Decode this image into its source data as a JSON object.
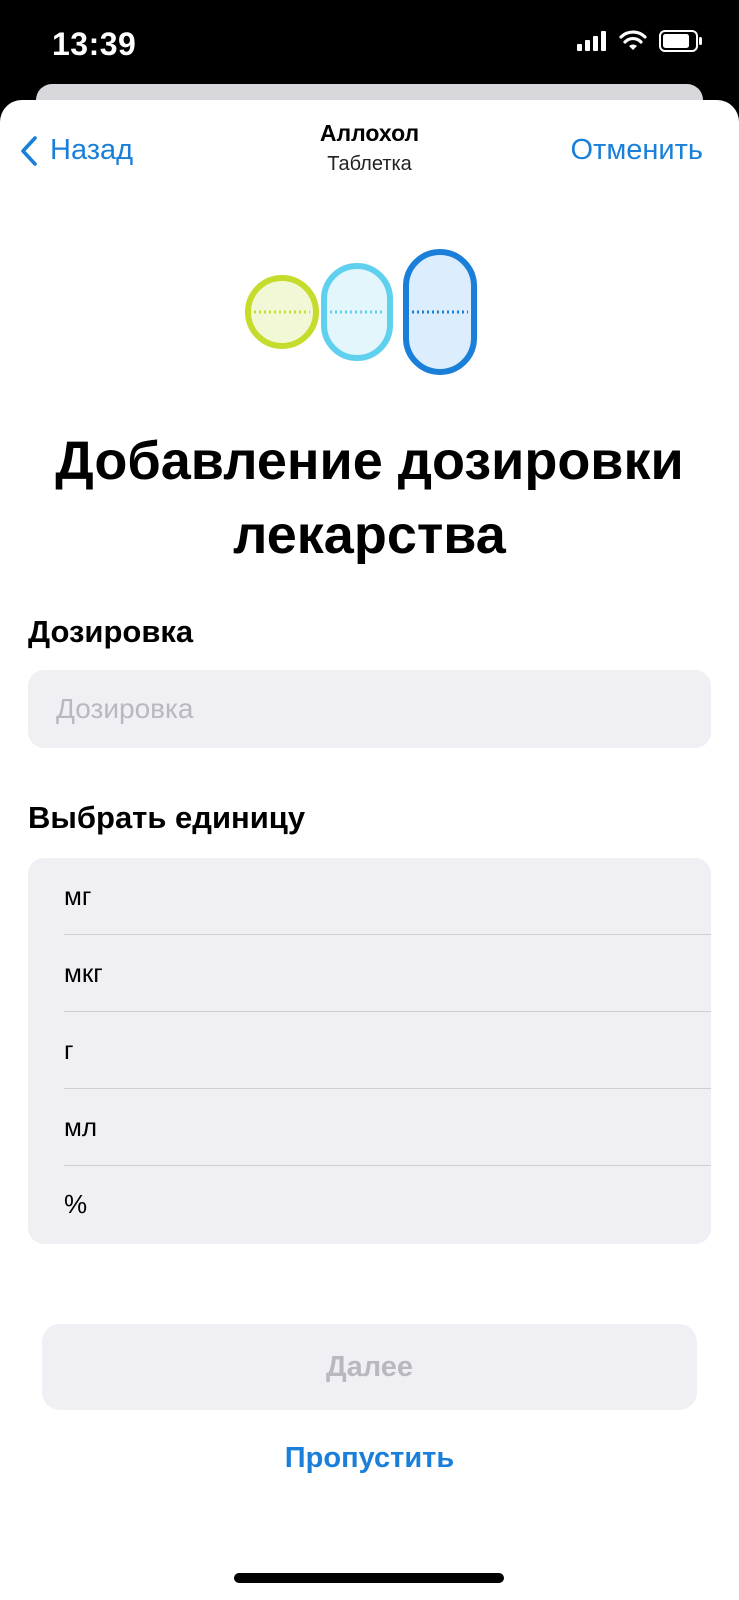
{
  "status_bar": {
    "time": "13:39"
  },
  "nav": {
    "back_label": "Назад",
    "title": "Аллохол",
    "subtitle": "Таблетка",
    "cancel_label": "Отменить"
  },
  "heading": "Добавление дозировки лекарства",
  "dosage": {
    "label": "Дозировка",
    "placeholder": "Дозировка",
    "value": ""
  },
  "units": {
    "label": "Выбрать единицу",
    "items": [
      "мг",
      "мкг",
      "г",
      "мл",
      "%"
    ]
  },
  "actions": {
    "next_label": "Далее",
    "skip_label": "Пропустить"
  },
  "colors": {
    "accent": "#1a7fd8",
    "pill_lime": "#c6dc2c",
    "pill_cyan": "#5fd0ee",
    "pill_blue": "#1a7fd8"
  },
  "icons": [
    "signal-icon",
    "wifi-icon",
    "battery-icon",
    "chevron-left-icon",
    "pills-illustration"
  ]
}
